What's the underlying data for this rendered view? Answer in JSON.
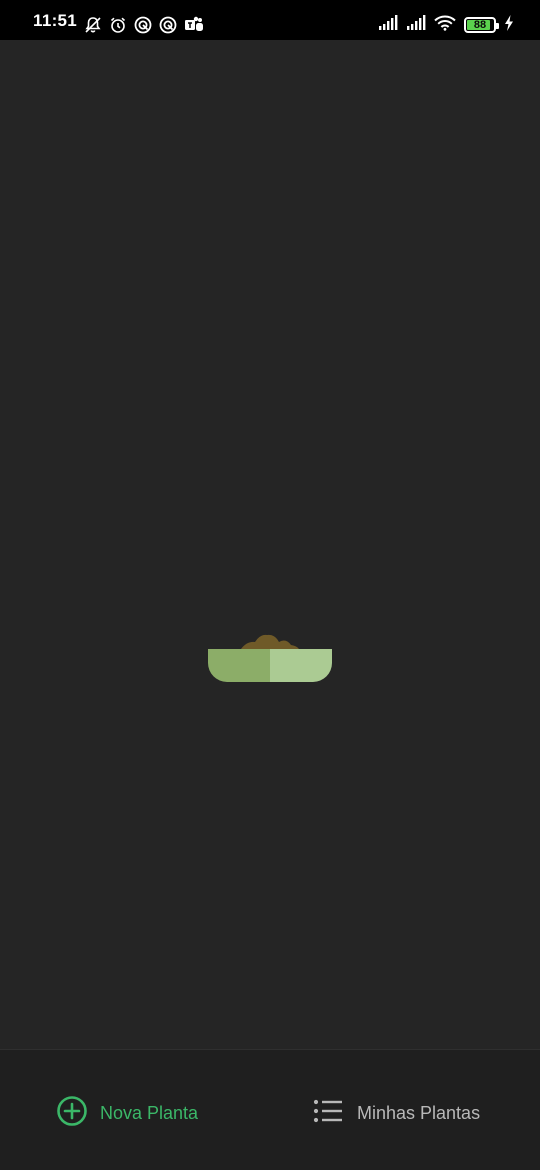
{
  "status_bar": {
    "time": "11:51",
    "battery_level": "88",
    "battery_fraction": 0.88,
    "left_icons": [
      "notifications-off-icon",
      "alarm-icon",
      "app-icon",
      "app-icon",
      "teams-icon"
    ],
    "right_icons": [
      "signal-icon",
      "signal-icon",
      "wifi-icon",
      "battery-icon",
      "charging-icon"
    ]
  },
  "main": {
    "loader_icon": "plant-pot-loading-icon"
  },
  "bottom_nav": {
    "new_plant_label": "Nova Planta",
    "new_plant_icon": "add-circle-icon",
    "my_plants_label": "Minhas Plantas",
    "my_plants_icon": "list-icon"
  },
  "colors": {
    "background": "#252525",
    "status_bar": "#000000",
    "nav_background": "#1f1f1f",
    "accent_green": "#3bb768",
    "inactive": "#b8b8b8",
    "pot_dark": "#8cad68",
    "pot_light": "#abcb93",
    "soil": "#6f5a28",
    "battery_green": "#5bd24e"
  }
}
